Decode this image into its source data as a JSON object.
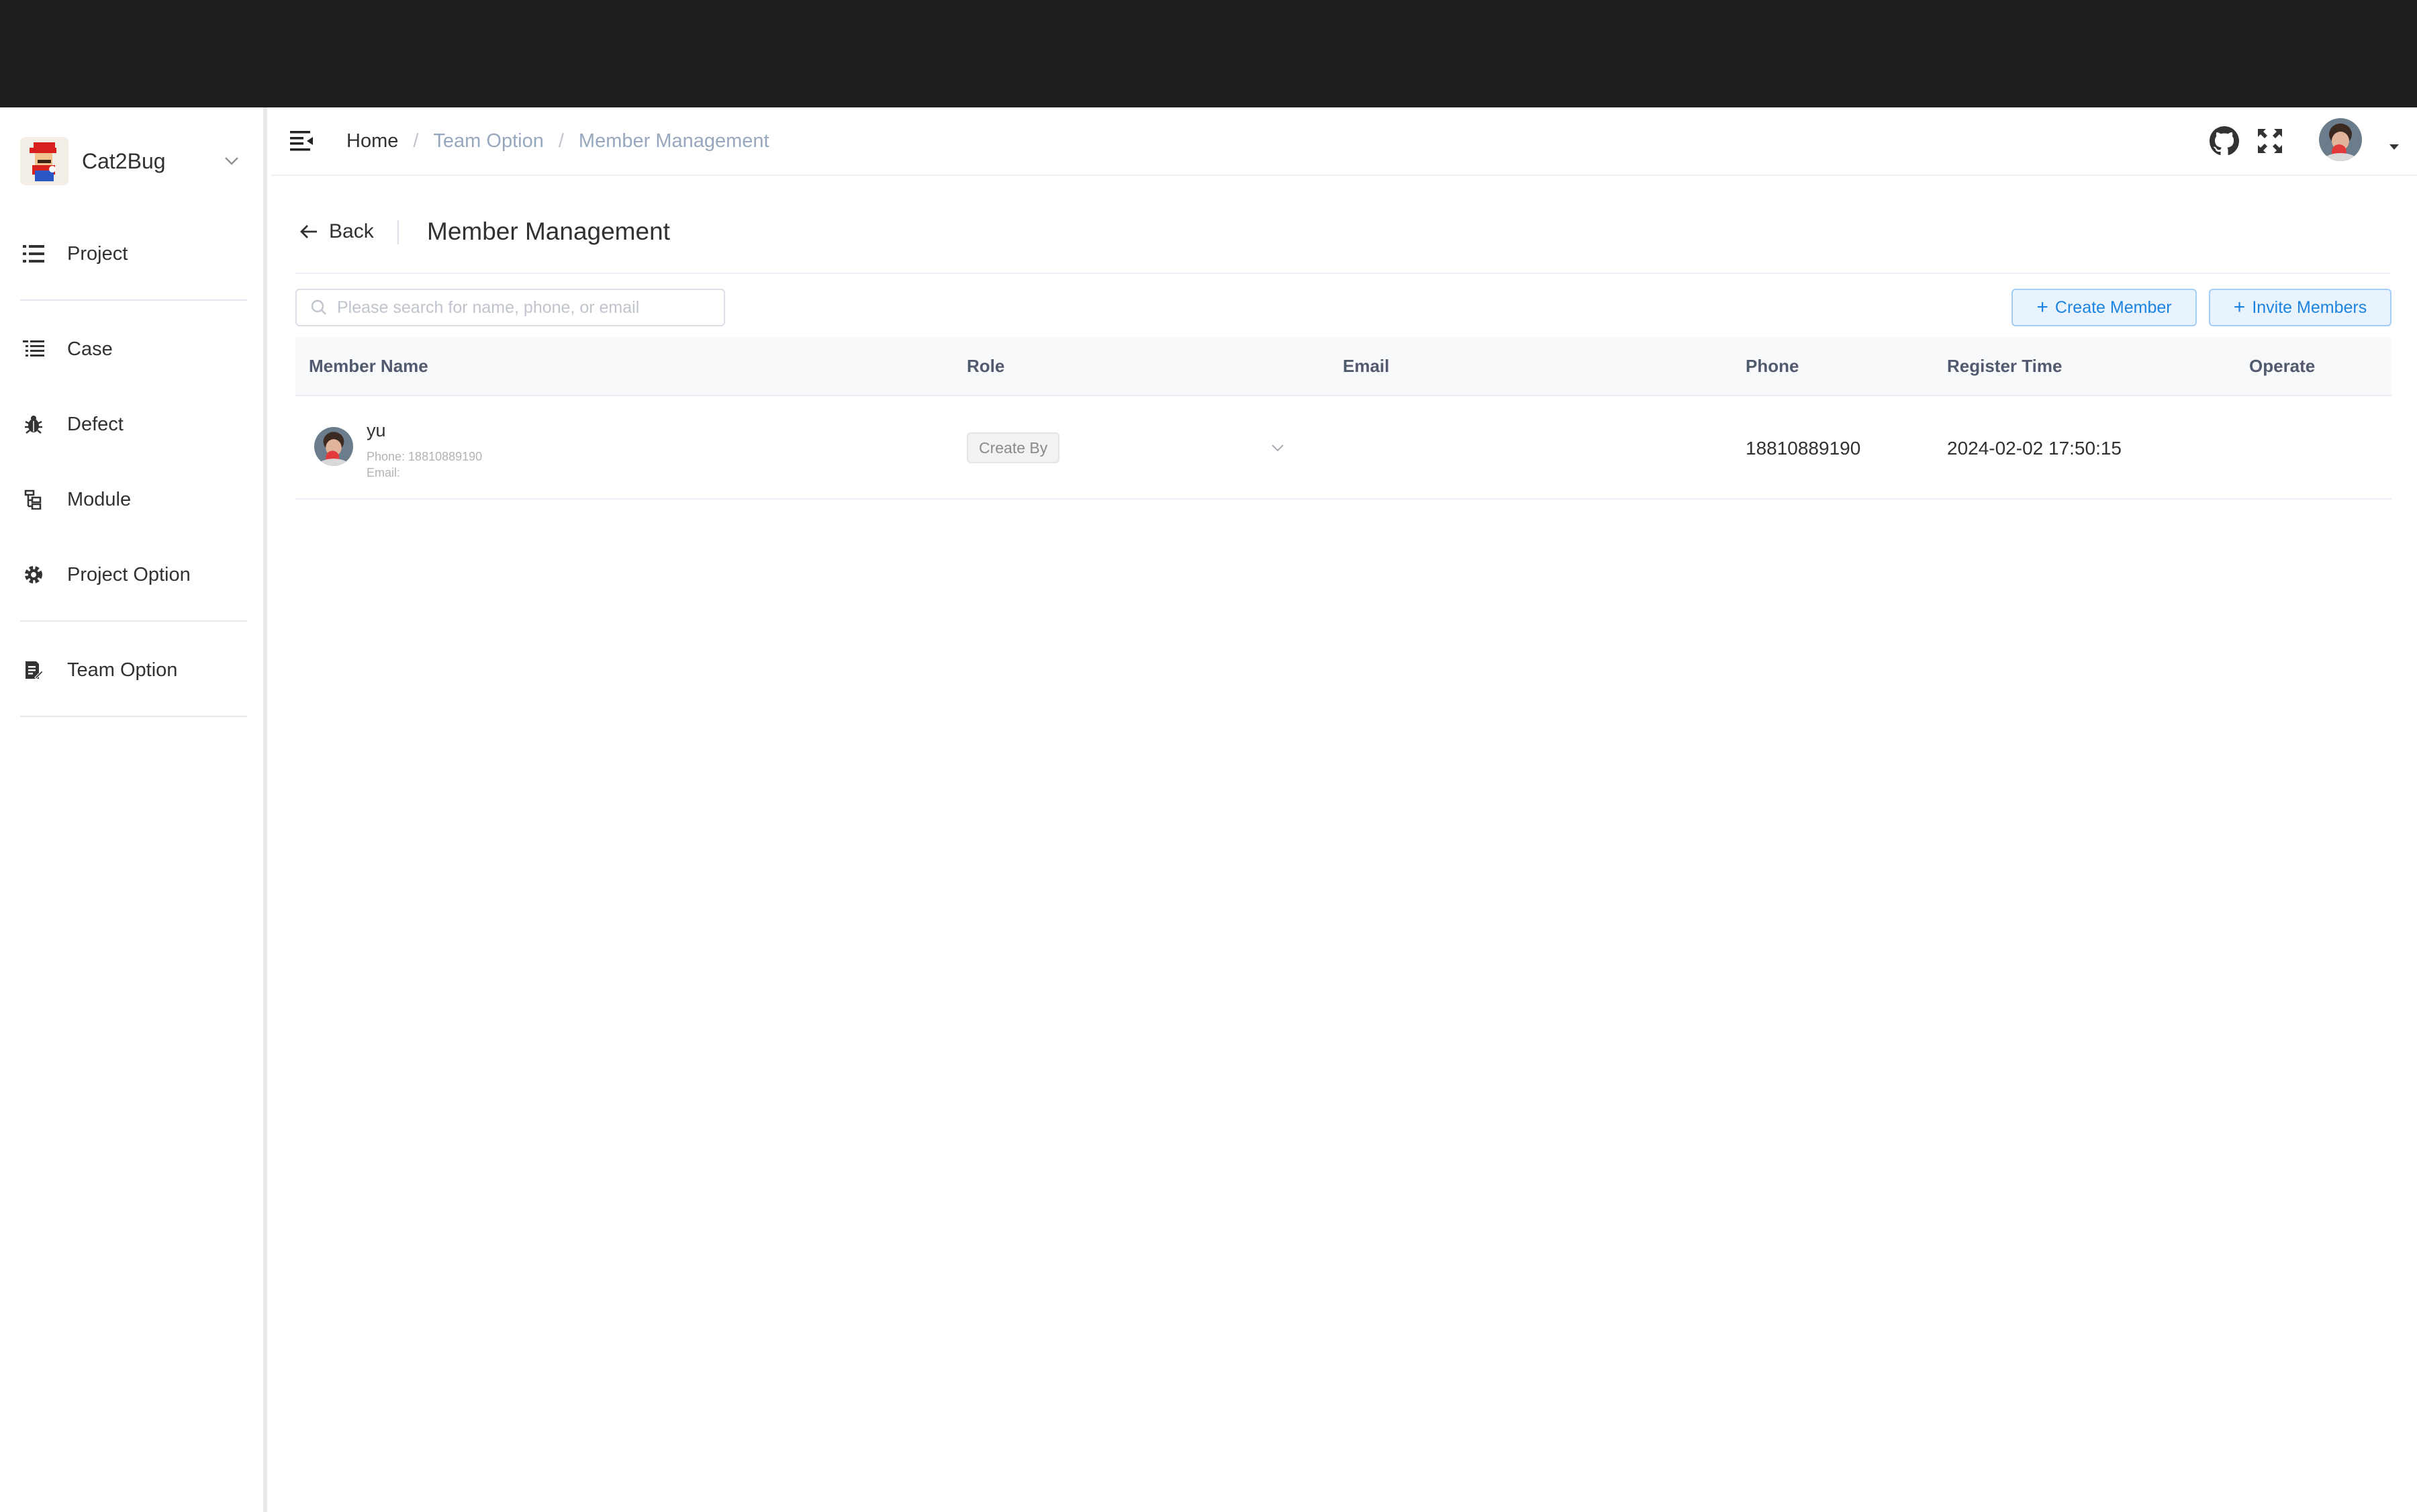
{
  "sidebar": {
    "team_name": "Cat2Bug",
    "items": [
      {
        "label": "Project",
        "icon": "list-icon"
      },
      {
        "label": "Case",
        "icon": "case-list-icon"
      },
      {
        "label": "Defect",
        "icon": "bug-icon"
      },
      {
        "label": "Module",
        "icon": "module-tree-icon"
      },
      {
        "label": "Project Option",
        "icon": "gear-icon"
      },
      {
        "label": "Team Option",
        "icon": "team-doc-icon"
      }
    ]
  },
  "navbar": {
    "breadcrumb": [
      "Home",
      "Team Option",
      "Member Management"
    ]
  },
  "page_header": {
    "back_label": "Back",
    "title": "Member Management"
  },
  "toolbar": {
    "search_placeholder": "Please search for name, phone, or email",
    "search_value": "",
    "create_member_label": "Create Member",
    "invite_members_label": "Invite Members"
  },
  "table": {
    "columns": [
      "Member Name",
      "Role",
      "Email",
      "Phone",
      "Register Time",
      "Operate"
    ],
    "rows": [
      {
        "name": "yu",
        "phone_line": "Phone: 18810889190",
        "email_line": "Email:",
        "role": "Create By",
        "email": "",
        "phone": "18810889190",
        "register_time": "2024-02-02 17:50:15",
        "operate": ""
      }
    ]
  },
  "colors": {
    "topbar": "#1f1f1f",
    "accent": "#1c84e0",
    "button_bg": "#e8f3fd",
    "header_row_bg": "#f8f9fa"
  }
}
